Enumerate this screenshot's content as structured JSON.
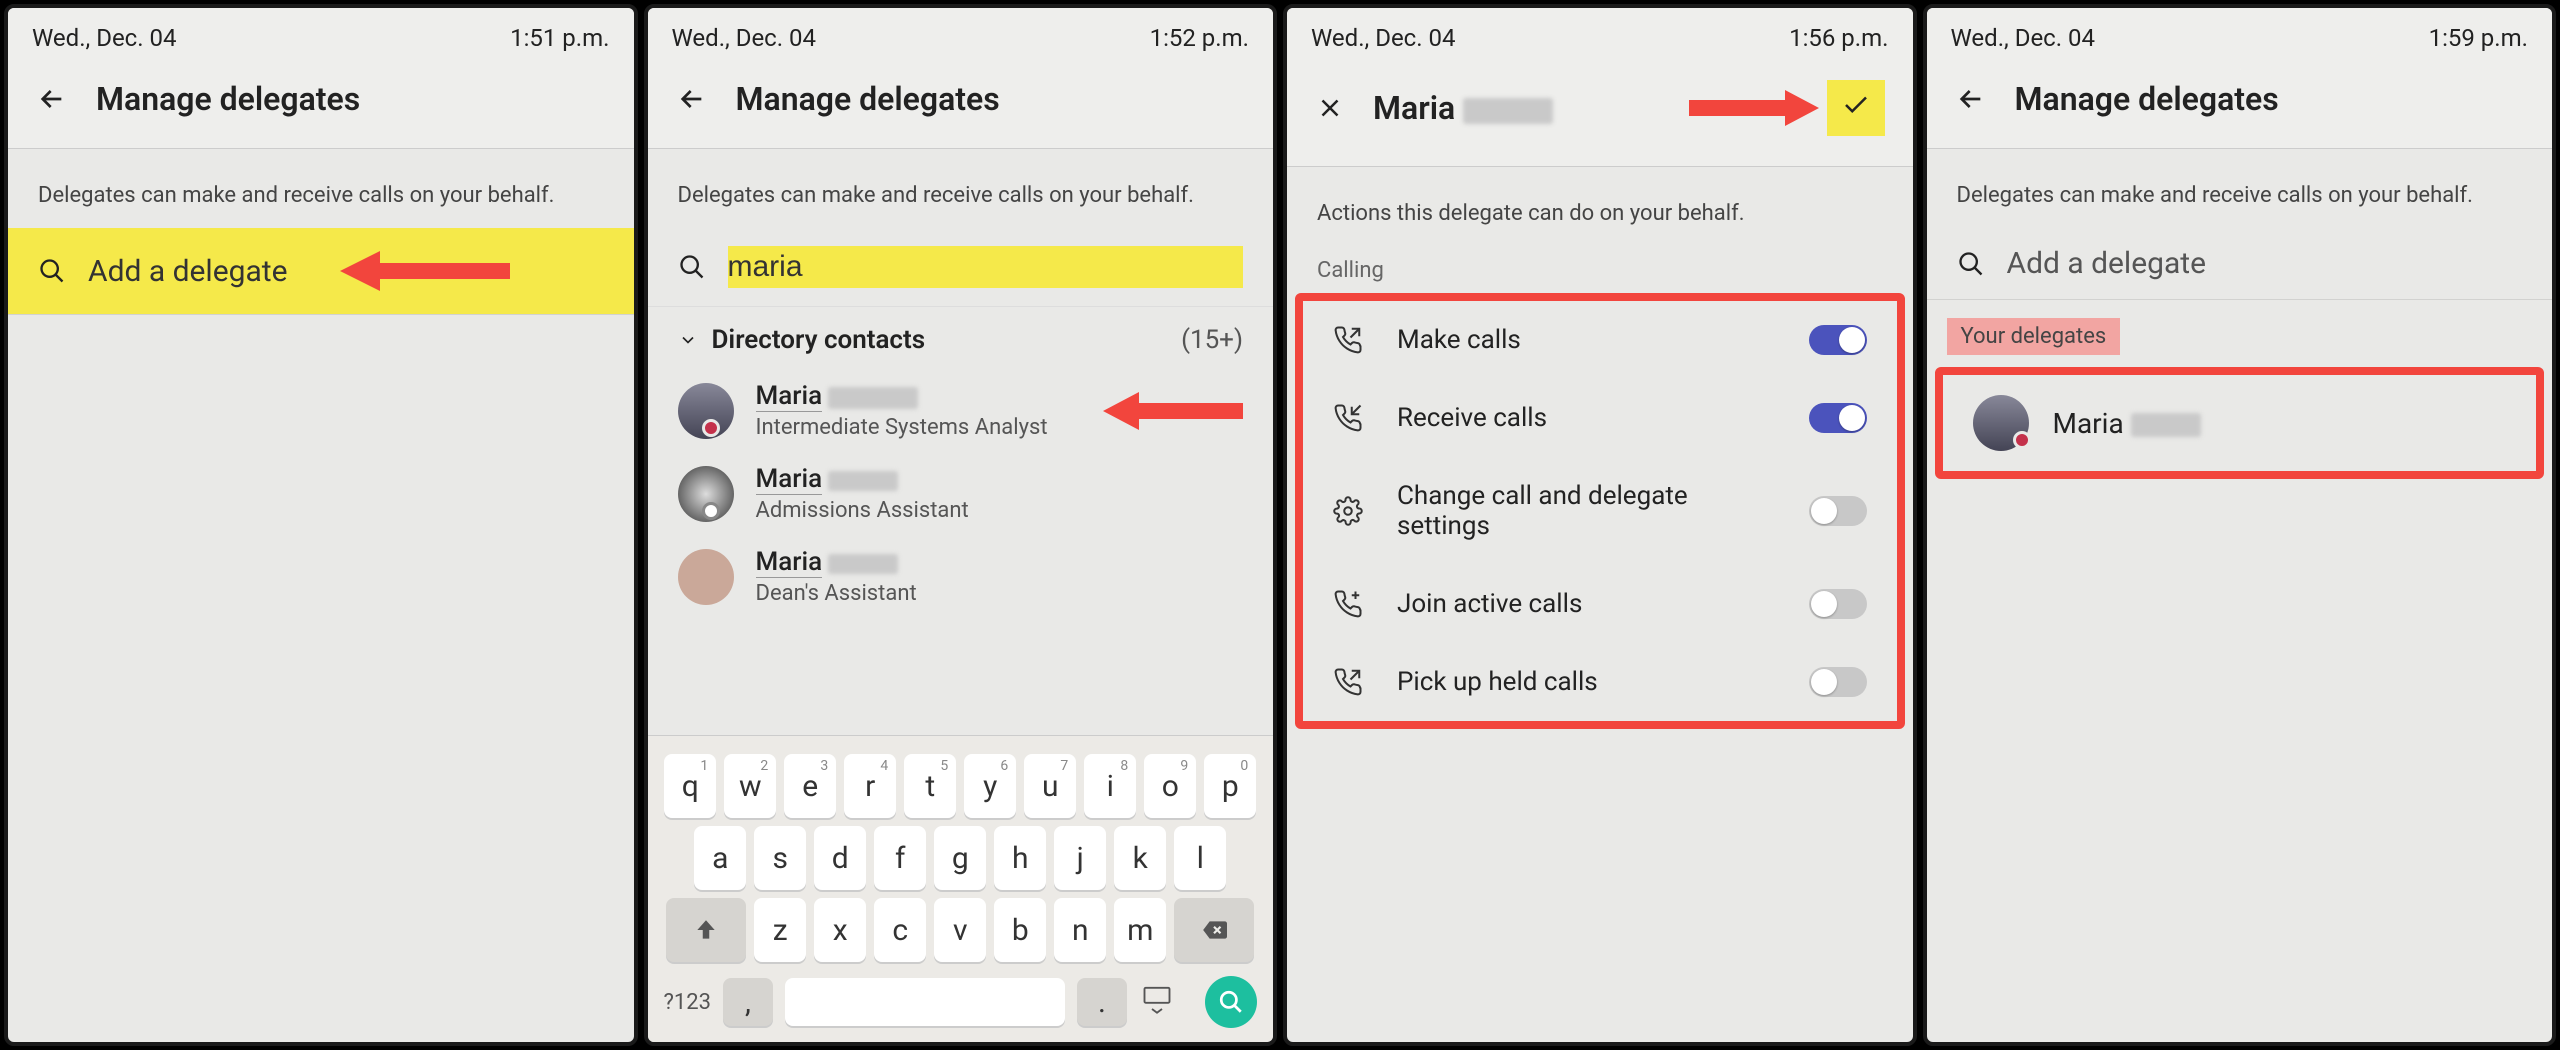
{
  "screens": [
    {
      "status": {
        "date": "Wed., Dec. 04",
        "time": "1:51 p.m."
      },
      "header_title": "Manage delegates",
      "subtitle": "Delegates can make and receive calls on your behalf.",
      "search_placeholder": "Add a delegate"
    },
    {
      "status": {
        "date": "Wed., Dec. 04",
        "time": "1:52 p.m."
      },
      "header_title": "Manage delegates",
      "subtitle": "Delegates can make and receive calls on your behalf.",
      "search_value": "maria",
      "directory": {
        "label": "Directory contacts",
        "count": "(15+)",
        "contacts": [
          {
            "name": "Maria",
            "role": "Intermediate Systems Analyst",
            "presence": "busy"
          },
          {
            "name": "Maria",
            "role": "Admissions Assistant",
            "presence": "off"
          },
          {
            "name": "Maria",
            "role": "Dean's Assistant",
            "presence": ""
          }
        ]
      },
      "keyboard": {
        "row1": [
          "q",
          "w",
          "e",
          "r",
          "t",
          "y",
          "u",
          "i",
          "o",
          "p"
        ],
        "row1_alt": [
          "1",
          "2",
          "3",
          "4",
          "5",
          "6",
          "7",
          "8",
          "9",
          "0"
        ],
        "row2": [
          "a",
          "s",
          "d",
          "f",
          "g",
          "h",
          "j",
          "k",
          "l"
        ],
        "row3": [
          "z",
          "x",
          "c",
          "v",
          "b",
          "n",
          "m"
        ],
        "sym": "?123"
      }
    },
    {
      "status": {
        "date": "Wed., Dec. 04",
        "time": "1:56 p.m."
      },
      "header_name": "Maria",
      "subtitle": "Actions this delegate can do on your behalf.",
      "section": "Calling",
      "permissions": [
        {
          "label": "Make calls",
          "on": true,
          "icon": "call-out"
        },
        {
          "label": "Receive calls",
          "on": true,
          "icon": "call-in"
        },
        {
          "label": "Change call and delegate settings",
          "on": false,
          "icon": "gear"
        },
        {
          "label": "Join active calls",
          "on": false,
          "icon": "call-add"
        },
        {
          "label": "Pick up held calls",
          "on": false,
          "icon": "call-hold"
        }
      ]
    },
    {
      "status": {
        "date": "Wed., Dec. 04",
        "time": "1:59 p.m."
      },
      "header_title": "Manage delegates",
      "subtitle": "Delegates can make and receive calls on your behalf.",
      "search_placeholder": "Add a delegate",
      "your_delegates_label": "Your delegates",
      "delegate": {
        "name": "Maria",
        "presence": "busy"
      }
    }
  ]
}
